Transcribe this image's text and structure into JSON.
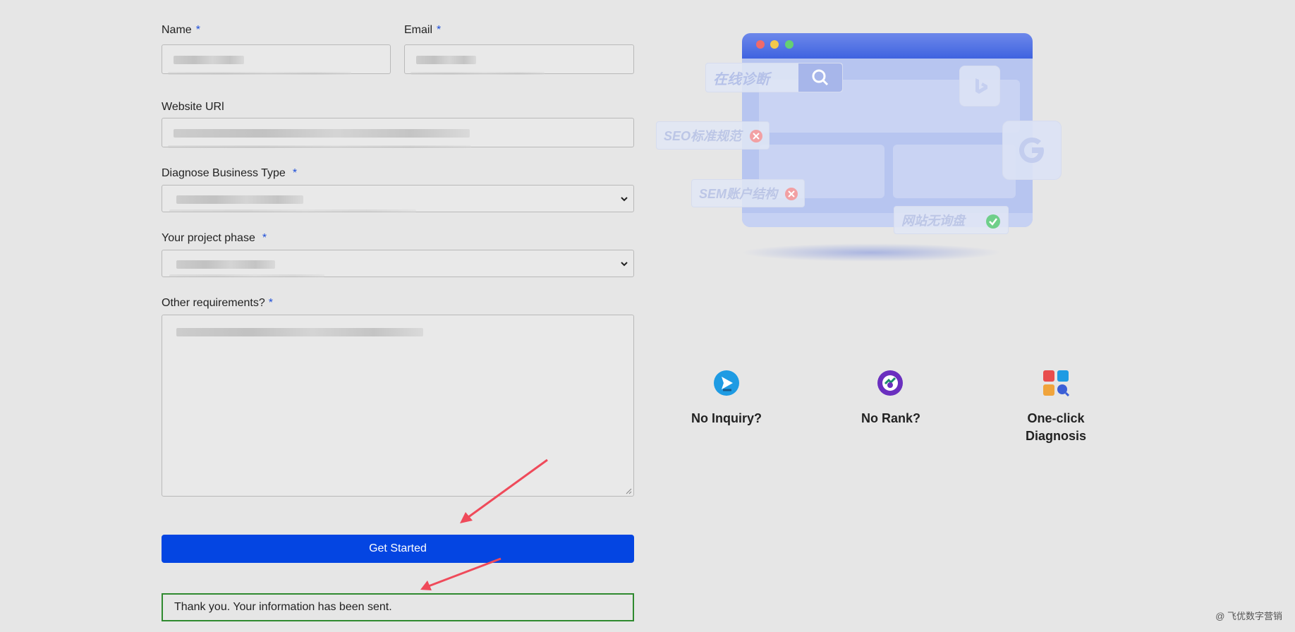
{
  "form": {
    "name_label": "Name",
    "email_label": "Email",
    "website_label": "Website URl",
    "business_type_label": "Diagnose Business Type",
    "project_phase_label": "Your project phase",
    "other_req_label": "Other requirements?",
    "required_mark": "*",
    "submit_label": "Get Started",
    "success_message": "Thank you. Your information has been sent."
  },
  "illustration": {
    "search_tag": "在线诊断",
    "seo_tag": "SEO标准规范",
    "sem_tag": "SEM账户结构",
    "inquiry_tag": "网站无询盘"
  },
  "features": [
    {
      "title": "No Inquiry?"
    },
    {
      "title": "No Rank?"
    },
    {
      "title": "One-click Diagnosis"
    }
  ],
  "watermark": "@ 飞优数字营销",
  "colors": {
    "accent": "#0445e2",
    "success_border": "#2f8a2f",
    "arrow": "#ef4a5a"
  }
}
